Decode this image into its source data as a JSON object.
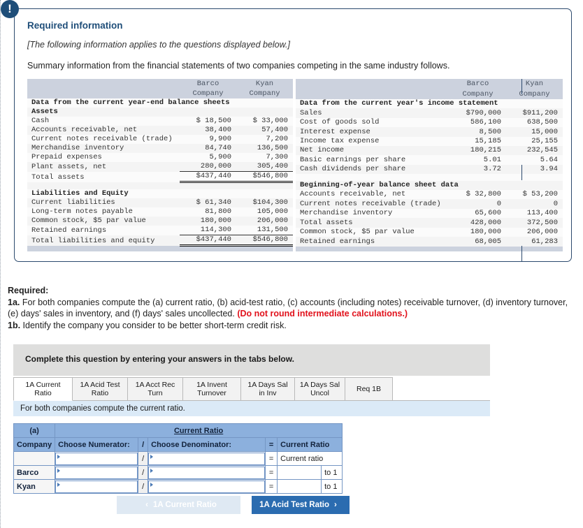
{
  "info": {
    "icon": "exclamation-icon",
    "title": "Required information",
    "applies_note": "[The following information applies to the questions displayed below.]",
    "summary": "Summary information from the financial statements of two companies competing in the same industry follows."
  },
  "left_table": {
    "col_headers": [
      "Barco",
      "Kyan"
    ],
    "col_subheaders": [
      "Company",
      "Company"
    ],
    "sections": [
      {
        "heading": "Data from the current year-end balance sheets",
        "subheading": "Assets",
        "rows": [
          {
            "label": "Cash",
            "barco": "$ 18,500",
            "kyan": "$ 33,000"
          },
          {
            "label": "Accounts receivable, net",
            "barco": "38,400",
            "kyan": "57,400"
          },
          {
            "label": "Current notes receivable (trade)",
            "barco": "9,900",
            "kyan": "7,200"
          },
          {
            "label": "Merchandise inventory",
            "barco": "84,740",
            "kyan": "136,500"
          },
          {
            "label": "Prepaid expenses",
            "barco": "5,900",
            "kyan": "7,300"
          },
          {
            "label": "Plant assets, net",
            "barco": "280,000",
            "kyan": "305,400",
            "underline": true
          }
        ],
        "total": {
          "label": "Total assets",
          "barco": "$437,440",
          "kyan": "$546,800"
        }
      },
      {
        "heading": "Liabilities and Equity",
        "rows": [
          {
            "label": "Current liabilities",
            "barco": "$ 61,340",
            "kyan": "$104,300"
          },
          {
            "label": "Long-term notes payable",
            "barco": "81,800",
            "kyan": "105,000"
          },
          {
            "label": "Common stock, $5 par value",
            "barco": "180,000",
            "kyan": "206,000"
          },
          {
            "label": "Retained earnings",
            "barco": "114,300",
            "kyan": "131,500",
            "underline": true
          }
        ],
        "total": {
          "label": "Total liabilities and equity",
          "barco": "$437,440",
          "kyan": "$546,800"
        }
      }
    ]
  },
  "right_table": {
    "col_headers": [
      "Barco",
      "Kyan"
    ],
    "col_subheaders": [
      "Company",
      "Company"
    ],
    "sections": [
      {
        "heading": "Data from the current year's income statement",
        "rows": [
          {
            "label": "Sales",
            "barco": "$790,000",
            "kyan": "$911,200"
          },
          {
            "label": "Cost of goods sold",
            "barco": "586,100",
            "kyan": "638,500"
          },
          {
            "label": "Interest expense",
            "barco": "8,500",
            "kyan": "15,000"
          },
          {
            "label": "Income tax expense",
            "barco": "15,185",
            "kyan": "25,155"
          },
          {
            "label": "Net income",
            "barco": "180,215",
            "kyan": "232,545"
          },
          {
            "label": "Basic earnings per share",
            "barco": "5.01",
            "kyan": "5.64"
          },
          {
            "label": "Cash dividends per share",
            "barco": "3.72",
            "kyan": "3.94"
          }
        ]
      },
      {
        "heading": "Beginning-of-year balance sheet data",
        "rows": [
          {
            "label": "Accounts receivable, net",
            "barco": "$ 32,800",
            "kyan": "$ 53,200"
          },
          {
            "label": "Current notes receivable (trade)",
            "barco": "0",
            "kyan": "0"
          },
          {
            "label": "Merchandise inventory",
            "barco": "65,600",
            "kyan": "113,400"
          },
          {
            "label": "Total assets",
            "barco": "428,000",
            "kyan": "372,500"
          },
          {
            "label": "Common stock, $5 par value",
            "barco": "180,000",
            "kyan": "206,000"
          }
        ],
        "tail": {
          "label": "Retained earnings",
          "barco": "68,005",
          "kyan": "61,283"
        }
      }
    ]
  },
  "required": {
    "heading": "Required:",
    "item_1a_label": "1a.",
    "item_1a_text": " For both companies compute the (a) current ratio, (b) acid-test ratio, (c) accounts (including notes) receivable turnover, (d) inventory turnover, (e) days' sales in inventory, and (f) days' sales uncollected. ",
    "item_1a_red": "(Do not round intermediate calculations.)",
    "item_1b_label": "1b.",
    "item_1b_text": " Identify the company you consider to be better short-term credit risk."
  },
  "complete_bar": {
    "text": "Complete this question by entering your answers in the tabs below."
  },
  "tabs": [
    {
      "label": "1A Current Ratio",
      "active": true
    },
    {
      "label": "1A Acid Test Ratio",
      "active": false
    },
    {
      "label": "1A Acct Rec Turn",
      "active": false
    },
    {
      "label": "1A Invent Turnover",
      "active": false
    },
    {
      "label": "1A Days Sal in Inv",
      "active": false
    },
    {
      "label": "1A Days Sal Uncol",
      "active": false
    },
    {
      "label": "Req 1B",
      "active": false
    }
  ],
  "prompt_strip": {
    "text": "For both companies compute the current ratio."
  },
  "answer_grid": {
    "part_label": "(a)",
    "title": "Current Ratio",
    "headers": {
      "company": "Company",
      "numerator": "Choose Numerator:",
      "slash": "/",
      "denominator": "Choose Denominator:",
      "equals": "=",
      "result": "Current Ratio"
    },
    "rows": [
      {
        "company": "",
        "slash": "/",
        "equals": "=",
        "result_label": "Current ratio",
        "to1": ""
      },
      {
        "company": "Barco",
        "slash": "/",
        "equals": "=",
        "result_label": "",
        "to1": "to 1"
      },
      {
        "company": "Kyan",
        "slash": "/",
        "equals": "=",
        "result_label": "",
        "to1": "to 1"
      }
    ]
  },
  "nav": {
    "prev_label": "1A Current Ratio",
    "prev_chevron": "‹",
    "next_label": "1A Acid Test Ratio",
    "next_chevron": "›"
  },
  "colors": {
    "accent_blue": "#1f4e79",
    "next_button": "#2b6cb0",
    "grid_header": "#8cb0dd",
    "prompt_strip": "#dbeaf7",
    "red_note": "#e1121c"
  }
}
